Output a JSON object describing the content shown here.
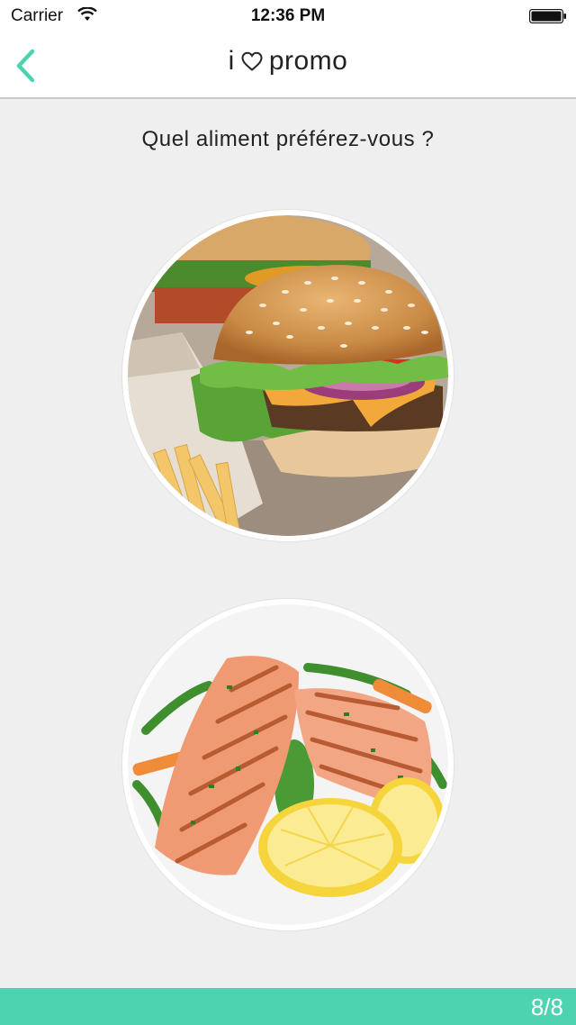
{
  "status_bar": {
    "carrier": "Carrier",
    "time": "12:36 PM",
    "icons": [
      "wifi-icon",
      "battery-icon"
    ]
  },
  "nav": {
    "back_icon": "chevron-left-icon",
    "title_left": "i",
    "title_icon": "heart-icon",
    "title_right": "promo"
  },
  "question": "Quel aliment préférez-vous ?",
  "choices": [
    {
      "name": "burger",
      "image": "burger-fries-photo"
    },
    {
      "name": "salmon",
      "image": "grilled-salmon-lemon-photo"
    }
  ],
  "progress": {
    "label": "8/8",
    "fraction": 1.0
  },
  "colors": {
    "accent": "#4ed3b0",
    "background": "#efefef",
    "bar": "#ffffff"
  }
}
